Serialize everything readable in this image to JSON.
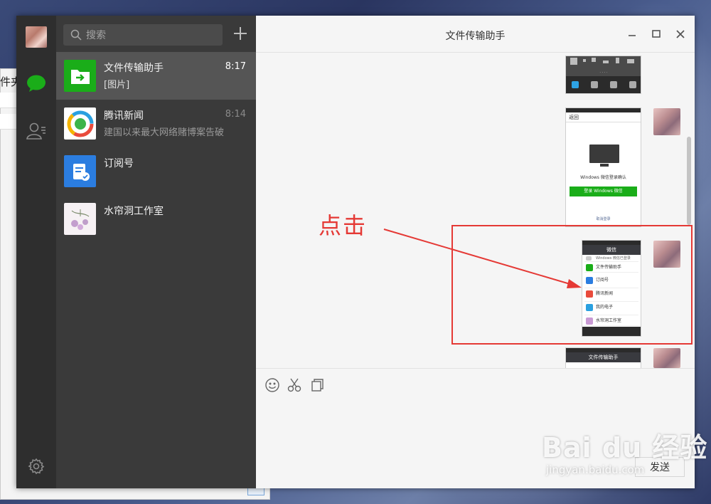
{
  "background_window": {
    "title_fragment": "件夹"
  },
  "sidebar": {
    "icons": [
      "avatar",
      "chat-icon",
      "contacts-icon",
      "settings-gear-icon"
    ]
  },
  "search": {
    "placeholder": "搜索"
  },
  "conversations": [
    {
      "name": "文件传输助手",
      "preview": "[图片]",
      "time": "8:17",
      "active": true
    },
    {
      "name": "腾讯新闻",
      "preview": "建国以来最大网络赌博案告破",
      "time": "8:14",
      "active": false
    },
    {
      "name": "订阅号",
      "preview": "",
      "time": "",
      "active": false
    },
    {
      "name": "水帘洞工作室",
      "preview": "",
      "time": "",
      "active": false
    }
  ],
  "chat": {
    "title": "文件传输助手",
    "send_label": "发送"
  },
  "phone_screens": {
    "screen2": {
      "nav": "返回",
      "caption": "Windows 微信登录确认",
      "button": "登录 Windows 微信",
      "cancel": "取消登录"
    },
    "screen3": {
      "nav": "微信",
      "rows": [
        "Windows 微信已登录",
        "文件传输助手",
        "订阅号",
        "腾讯新闻",
        "我的电子",
        "水帘洞工作室"
      ]
    },
    "screen4": {
      "nav": "文件传输助手"
    }
  },
  "annotation": {
    "label": "点击",
    "color": "#e53935"
  },
  "watermark": {
    "brand": "Bai du 经验",
    "url": "jingyan.baidu.com"
  },
  "colors": {
    "rail": "#2e2e2e",
    "list": "#3a3a3a",
    "active_item": "#555555",
    "wechat_green": "#1aad19"
  }
}
